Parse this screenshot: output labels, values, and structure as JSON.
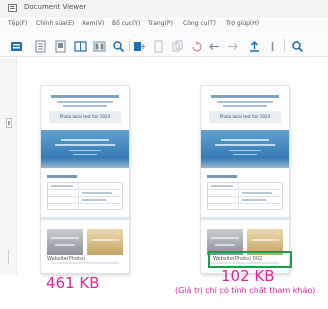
{
  "window": {
    "title": "Document Viewer",
    "menu": [
      "Tệp(F)",
      "Chỉnh sửa(E)",
      "Xem(V)",
      "Bố cục(Y)",
      "Trang(P)",
      "Công cụ(T)",
      "Trợ giúp(H)"
    ]
  },
  "toolbar": {
    "icons": [
      "menu-icon",
      "open-icon",
      "page-icon",
      "two-page-icon",
      "zoom-icon",
      "insert-icon",
      "thumbnail-icon",
      "rotate-icon",
      "back-icon",
      "forward-icon",
      "export-icon",
      "search-icon"
    ],
    "colors": {
      "accent": "#1f6fb5",
      "secondary": "#7a8a99",
      "highlight": "#e0239a"
    }
  },
  "documents": [
    {
      "banner_title": "Photo local test fair 2024",
      "file_label": "Website(Photo)",
      "size": "461 KB"
    },
    {
      "banner_title": "Photo local test fair 2024",
      "file_label": "Website(Photo) 002",
      "size": "102 KB"
    }
  ],
  "note": "(Giá trị chỉ có tính chất tham khảo)",
  "colors": {
    "size_text": "#e0239a",
    "highlight_box": "#16a04d"
  }
}
